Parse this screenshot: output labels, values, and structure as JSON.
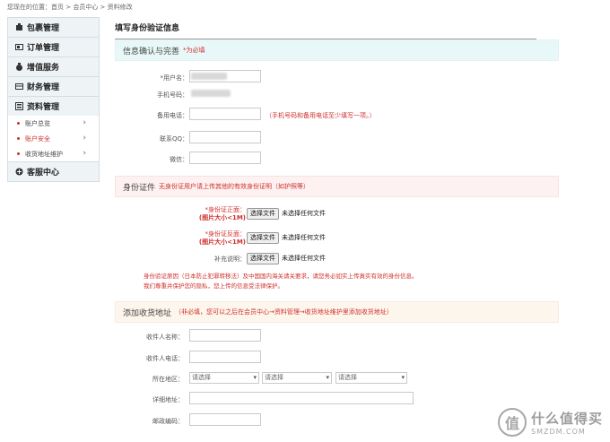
{
  "breadcrumb": "您现在的位置：首页 > 会员中心 > 资料修改",
  "sidebar": {
    "items": [
      {
        "label": "包裹管理",
        "icon": "package-icon"
      },
      {
        "label": "订单管理",
        "icon": "order-icon"
      },
      {
        "label": "增值服务",
        "icon": "money-bag-icon"
      },
      {
        "label": "财务管理",
        "icon": "finance-icon"
      },
      {
        "label": "资料管理",
        "icon": "profile-icon"
      },
      {
        "label": "客服中心",
        "icon": "plus-circle-icon"
      }
    ],
    "subitems": [
      {
        "label": "账户总览"
      },
      {
        "label": "账户安全"
      },
      {
        "label": "收货地址维护"
      }
    ],
    "chevron": "›"
  },
  "page_title": "填写身份验证信息",
  "sec1": {
    "title": "信息确认与完善",
    "required_note": "*为必填",
    "username_label": "*用户名：",
    "phone_label": "手机号码：",
    "backup_label": "备用电话：",
    "backup_hint": "（手机号码和备用电话至少填写一项。）",
    "qq_label": "联系QQ：",
    "wechat_label": "微信："
  },
  "sec2": {
    "title": "身份证件",
    "note": "无身份证用户请上传其他的有效身份证明（如护照等）",
    "front_label": "*身份证正面：",
    "front_size": "(图片大小<1M)",
    "back_label": "*身份证反面：",
    "back_size": "(图片大小<1M)",
    "extra_label": "补充说明：",
    "choose_file": "选择文件",
    "no_file": "未选择任何文件",
    "warning_line1": "身份验证原因（日本防止犯罪转移法）及中国国内海关请关要求，请您务必如实上传真实有效的身份信息。",
    "warning_line2": "我们尊重并保护您的隐私，您上传的信息受法律保护。"
  },
  "sec3": {
    "title": "添加收货地址",
    "note": "（非必填，您可以之后在会员中心→资料管理→收货地址维护里添加收货地址）",
    "name_label": "收件人名称：",
    "phone_label": "收件人电话：",
    "region_label": "所在地区：",
    "select_placeholder": "请选择",
    "address_label": "详细地址：",
    "zip_label": "邮政编码："
  },
  "watermark": {
    "logo": "值",
    "cn": "什么值得买",
    "en": "SMZDM.COM"
  },
  "colors": {
    "accent_red": "#d0312d",
    "section_blue": "#e8f8f8",
    "section_pink": "#fdf1f1",
    "section_cream": "#fdf6ec"
  }
}
